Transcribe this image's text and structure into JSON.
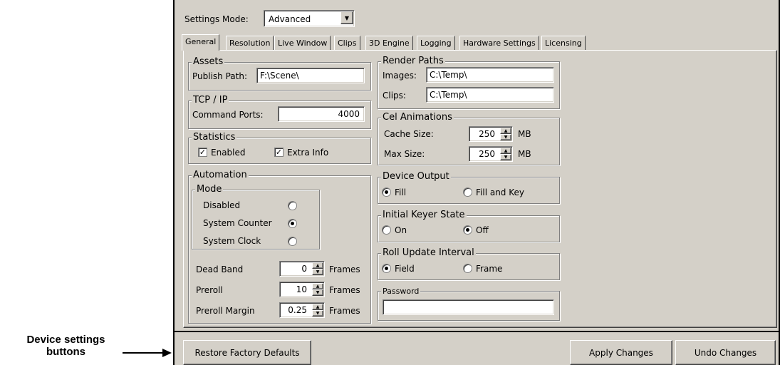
{
  "annotation": {
    "label": "Device settings buttons"
  },
  "settings_mode": {
    "label": "Settings Mode:",
    "value": "Advanced"
  },
  "tabs": [
    {
      "label": "General"
    },
    {
      "label": "Resolution"
    },
    {
      "label": "Live Window"
    },
    {
      "label": "Clips"
    },
    {
      "label": "3D Engine"
    },
    {
      "label": "Logging"
    },
    {
      "label": "Hardware Settings"
    },
    {
      "label": "Licensing"
    }
  ],
  "assets": {
    "title": "Assets",
    "publish_label": "Publish Path:",
    "publish_value": "F:\\Scene\\"
  },
  "tcpip": {
    "title": "TCP / IP",
    "ports_label": "Command Ports:",
    "ports_value": "4000"
  },
  "statistics": {
    "title": "Statistics",
    "enabled_label": "Enabled",
    "extra_label": "Extra Info"
  },
  "automation": {
    "title": "Automation",
    "mode_title": "Mode",
    "disabled_label": "Disabled",
    "counter_label": "System Counter",
    "clock_label": "System Clock",
    "deadband_label": "Dead Band",
    "deadband_value": "0",
    "preroll_label": "Preroll",
    "preroll_value": "10",
    "margin_label": "Preroll Margin",
    "margin_value": "0.25",
    "frames_label": "Frames"
  },
  "render_paths": {
    "title": "Render Paths",
    "images_label": "Images:",
    "images_value": "C:\\Temp\\",
    "clips_label": "Clips:",
    "clips_value": "C:\\Temp\\"
  },
  "cel": {
    "title": "Cel Animations",
    "cache_label": "Cache Size:",
    "cache_value": "250",
    "max_label": "Max Size:",
    "max_value": "250",
    "unit": "MB"
  },
  "device_output": {
    "title": "Device Output",
    "fill_label": "Fill",
    "fillkey_label": "Fill and Key"
  },
  "keyer": {
    "title": "Initial Keyer State",
    "on_label": "On",
    "off_label": "Off"
  },
  "roll": {
    "title": "Roll Update Interval",
    "field_label": "Field",
    "frame_label": "Frame"
  },
  "password": {
    "title": "Password",
    "value": ""
  },
  "buttons": {
    "restore": "Restore Factory Defaults",
    "apply": "Apply Changes",
    "undo": "Undo Changes"
  },
  "colors": {
    "dialog_bg": "#d4d0c8"
  }
}
